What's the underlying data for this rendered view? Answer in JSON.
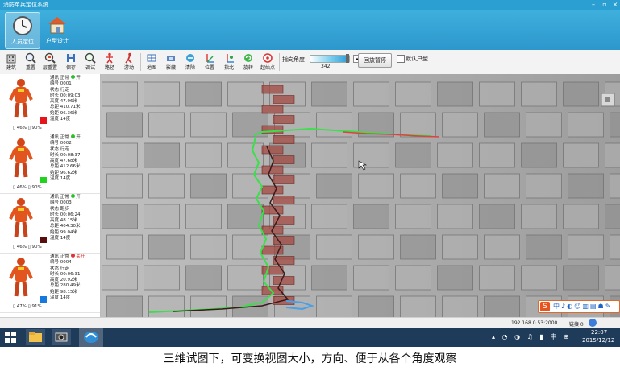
{
  "window": {
    "title": "消防单兵定位系统"
  },
  "ribbon": {
    "buttons": [
      {
        "label": "人员定位",
        "icon": "clock-icon",
        "active": true
      },
      {
        "label": "户型设计",
        "icon": "house-icon",
        "active": false
      }
    ]
  },
  "toolbar": {
    "buttons": [
      {
        "label": "建筑",
        "icon": "building-icon"
      },
      {
        "label": "重置",
        "icon": "zoom-reset-icon"
      },
      {
        "label": "层重置",
        "icon": "layer-reset-icon"
      },
      {
        "label": "保存",
        "icon": "save-icon"
      },
      {
        "label": "调试",
        "icon": "debug-icon"
      },
      {
        "label": "路径",
        "icon": "path-icon"
      },
      {
        "label": "游动",
        "icon": "walk-icon"
      },
      {
        "label": "地图",
        "icon": "map-icon"
      },
      {
        "label": "影藏",
        "icon": "hide-icon"
      },
      {
        "label": "清除",
        "icon": "clear-icon"
      },
      {
        "label": "位置",
        "icon": "position-icon"
      },
      {
        "label": "指北",
        "icon": "north-icon"
      },
      {
        "label": "旋转",
        "icon": "rotate-icon"
      },
      {
        "label": "起始点",
        "icon": "start-point-icon"
      }
    ],
    "angle_label": "指向角度",
    "angle_value": "342",
    "pause_button": "回放暂停",
    "default_floor_label": "默认户型"
  },
  "personnel": [
    {
      "comm": "通讯 正常",
      "switch": "开",
      "id": "编号 0001",
      "status": "状态 行走",
      "duration": "时长 00:09:03",
      "height": "高度 47.96米",
      "distance": "总距 410.71米",
      "aim": "始距 96.36米",
      "temp": "温度 14度",
      "battery1": "46%",
      "battery2": "90%",
      "color": "#e8141c",
      "switch_on": true
    },
    {
      "comm": "通讯 正常",
      "switch": "开",
      "id": "编号 0002",
      "status": "状态 行走",
      "duration": "时长 00:08:37",
      "height": "高度 47.68米",
      "distance": "总距 412.66米",
      "aim": "始距 96.62米",
      "temp": "温度 14度",
      "battery1": "46%",
      "battery2": "90%",
      "color": "#20d41e",
      "switch_on": true
    },
    {
      "comm": "通讯 正常",
      "switch": "开",
      "id": "编号 0003",
      "status": "状态 跑步",
      "duration": "时长 00:06:24",
      "height": "高度 48.15米",
      "distance": "总距 404.30米",
      "aim": "始距 99.04米",
      "temp": "温度 14度",
      "battery1": "46%",
      "battery2": "90%",
      "color": "#5a0d0d",
      "switch_on": true
    },
    {
      "comm": "通讯 正常",
      "switch": "关开",
      "id": "编号 0004",
      "status": "状态 行走",
      "duration": "时长 00:06:31",
      "height": "高度 20.92米",
      "distance": "总距 280.49米",
      "aim": "始距 98.15米",
      "temp": "温度 14度",
      "battery1": "47%",
      "battery2": "91%",
      "color": "#1778e0",
      "switch_on": false
    }
  ],
  "statusbar": {
    "address": "192.168.0.53:2000",
    "link": "链接 0"
  },
  "taskbar": {
    "time": "22:07",
    "date": "2015/12/12"
  },
  "caption": "三维试图下，可变换视图大小，方向、便于从各个角度观察"
}
